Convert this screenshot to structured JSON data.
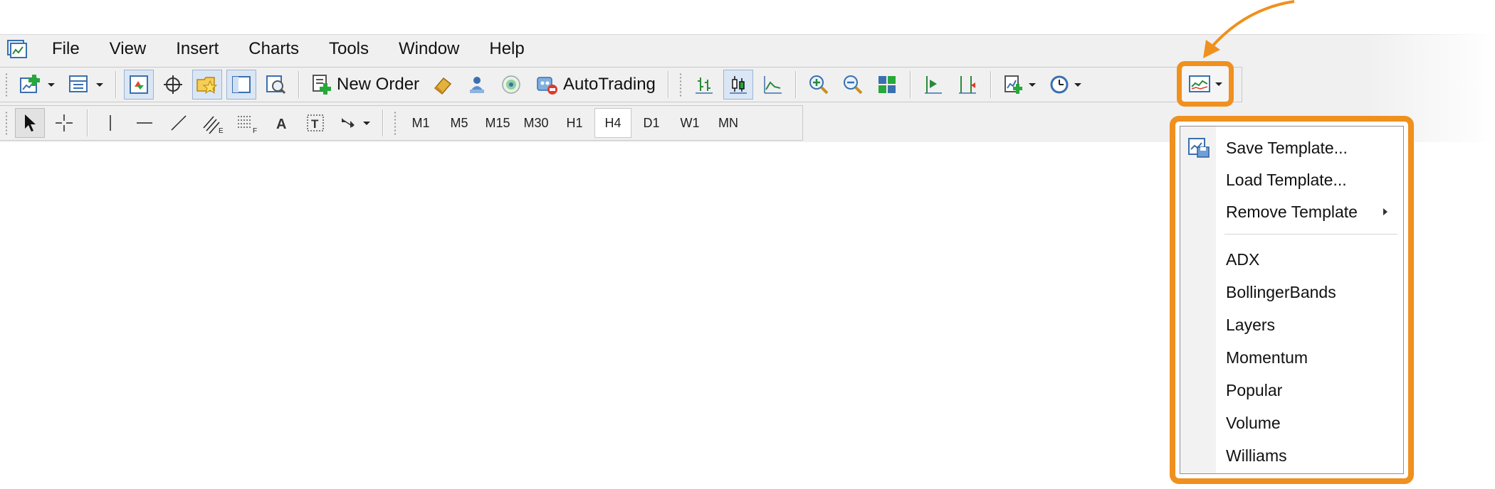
{
  "menubar": {
    "items": [
      "File",
      "View",
      "Insert",
      "Charts",
      "Tools",
      "Window",
      "Help"
    ]
  },
  "toolbar_standard": {
    "new_order_label": "New Order",
    "autotrading_label": "AutoTrading"
  },
  "toolbar_timeframes": {
    "items": [
      "M1",
      "M5",
      "M15",
      "M30",
      "H1",
      "H4",
      "D1",
      "W1",
      "MN"
    ],
    "active": "H4"
  },
  "template_menu": {
    "save": "Save Template...",
    "load": "Load Template...",
    "remove": "Remove Template",
    "templates": [
      "ADX",
      "BollingerBands",
      "Layers",
      "Momentum",
      "Popular",
      "Volume",
      "Williams"
    ]
  },
  "colors": {
    "highlight": "#f0901e",
    "toolbar_bg": "#f0f0f0",
    "pressed_bg": "#dbe6f4"
  },
  "icons": [
    "app-icon",
    "new-chart-icon",
    "profiles-icon",
    "market-watch-icon",
    "data-window-icon",
    "navigator-icon",
    "terminal-icon",
    "strategy-tester-icon",
    "new-order-icon",
    "metaeditor-icon",
    "signals-icon",
    "market-icon",
    "autotrading-icon",
    "bar-chart-icon",
    "candlesticks-icon",
    "line-chart-icon",
    "zoom-in-icon",
    "zoom-out-icon",
    "tile-windows-icon",
    "chart-shift-icon",
    "autoscroll-icon",
    "indicators-icon",
    "periods-icon",
    "templates-icon",
    "cursor-icon",
    "crosshair-icon",
    "vertical-line-icon",
    "horizontal-line-icon",
    "trendline-icon",
    "equidistant-channel-icon",
    "fibonacci-icon",
    "text-icon",
    "text-label-icon",
    "arrows-icon"
  ]
}
